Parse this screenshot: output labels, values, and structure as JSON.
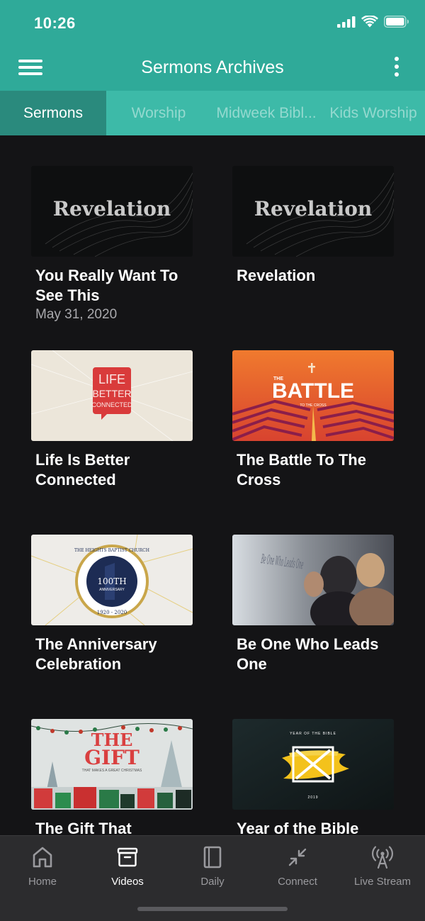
{
  "status": {
    "time": "10:26"
  },
  "header": {
    "title": "Sermons Archives"
  },
  "tabs": [
    {
      "label": "Sermons",
      "active": true
    },
    {
      "label": "Worship",
      "active": false
    },
    {
      "label": "Midweek Bibl...",
      "active": false
    },
    {
      "label": "Kids Worship",
      "active": false
    }
  ],
  "cards": [
    {
      "title": "You Really Want To See This",
      "date": "May 31, 2020",
      "thumb_text": "Revelation"
    },
    {
      "title": "Revelation",
      "date": "",
      "thumb_text": "Revelation"
    },
    {
      "title": "Life Is Better Connected",
      "date": "",
      "thumb_text_1": "LIFE",
      "thumb_text_2": "BETTER",
      "thumb_text_3": "CONNECTED"
    },
    {
      "title": "The Battle To The Cross",
      "date": "",
      "thumb_text": "BATTLE",
      "thumb_small_1": "THE",
      "thumb_small_2": "TO THE CROSS"
    },
    {
      "title": "The Anniversary Celebration",
      "date": "",
      "thumb_text": "100TH",
      "thumb_small": "ANNIVERSARY",
      "thumb_ring_top": "THE HEIGHTS BAPTIST CHURCH",
      "thumb_years": "1920 - 2020"
    },
    {
      "title": "Be One Who Leads One",
      "date": "",
      "thumb_text": "Be One Who Leads One"
    },
    {
      "title": "The Gift That",
      "date": "",
      "thumb_text_1": "THE",
      "thumb_text_2": "GIFT",
      "thumb_small": "THAT MAKES A GREAT CHRISTMAS"
    },
    {
      "title": "Year of the Bible",
      "date": "",
      "thumb_top": "YEAR OF THE BIBLE",
      "thumb_bottom": "2019"
    }
  ],
  "nav": [
    {
      "label": "Home",
      "icon": "home-icon",
      "active": false
    },
    {
      "label": "Videos",
      "icon": "videos-icon",
      "active": true
    },
    {
      "label": "Daily",
      "icon": "book-icon",
      "active": false
    },
    {
      "label": "Connect",
      "icon": "connect-icon",
      "active": false
    },
    {
      "label": "Live Stream",
      "icon": "broadcast-icon",
      "active": false
    }
  ],
  "colors": {
    "header": "#2faa99",
    "tabs": "#3dbaa8",
    "active_tab": "#2a8a7d",
    "background": "#141416",
    "nav": "#2c2c2e"
  }
}
